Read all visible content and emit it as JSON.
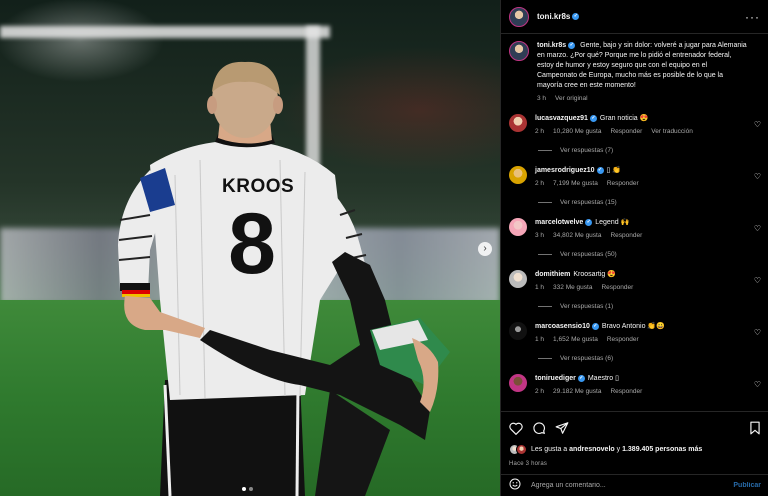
{
  "post": {
    "username": "toni.kr8s",
    "jersey_name": "KROOS",
    "jersey_number": "8",
    "caption": "Gente, bajo y sin dolor: volveré a jugar para Alemania en marzo. ¿Por qué? Porque me lo pidió el entrenador federal, estoy de humor y estoy seguro que con el equipo en el Campeonato de Europa, mucho más es posible de lo que la mayoría cree en este momento!",
    "caption_time": "3 h",
    "see_translation_original": "Ver original",
    "likes_prefix": "Les gusta a",
    "likes_user": "andresnovelo",
    "likes_and": "y",
    "likes_count": "1.389.405 personas más",
    "time_ago": "Hace 3 horas",
    "comment_placeholder": "Agrega un comentario...",
    "publish_label": "Publicar",
    "carousel": {
      "current": 1,
      "total": 2
    }
  },
  "comments": [
    {
      "user": "lucasvazquez91",
      "text": "Gran noticia 😍",
      "time": "2 h",
      "likes": "10,280 Me gusta",
      "reply": "Responder",
      "translate": "Ver traducción",
      "replies": "Ver respuestas (7)"
    },
    {
      "user": "jamesrodriguez10",
      "text": "▯ 👏",
      "time": "2 h",
      "likes": "7,199 Me gusta",
      "reply": "Responder",
      "translate": "",
      "replies": "Ver respuestas (15)"
    },
    {
      "user": "marcelotwelve",
      "text": "Legend 🙌",
      "time": "3 h",
      "likes": "34,802 Me gusta",
      "reply": "Responder",
      "translate": "",
      "replies": "Ver respuestas (50)"
    },
    {
      "user": "domithiem",
      "text": "Kroosartig 😍",
      "time": "1 h",
      "likes": "332 Me gusta",
      "reply": "Responder",
      "translate": "",
      "replies": "Ver respuestas (1)"
    },
    {
      "user": "marcoasensio10",
      "text": "Bravo Antonio 👏😀",
      "time": "1 h",
      "likes": "1,652 Me gusta",
      "reply": "Responder",
      "translate": "",
      "replies": "Ver respuestas (6)"
    },
    {
      "user": "toniruediger",
      "text": "Maestro ▯",
      "time": "2 h",
      "likes": "29.182 Me gusta",
      "reply": "Responder",
      "translate": "",
      "replies": ""
    }
  ],
  "icons": {
    "like": "heart-icon",
    "comment": "comment-icon",
    "share": "paper-plane-icon",
    "save": "bookmark-icon",
    "more": "more-options-icon",
    "emoji": "smiley-icon"
  },
  "colors": {
    "background": "#000000",
    "link_blue": "#3897f0",
    "muted": "#a8a8a8",
    "verified": "#3897f0"
  }
}
